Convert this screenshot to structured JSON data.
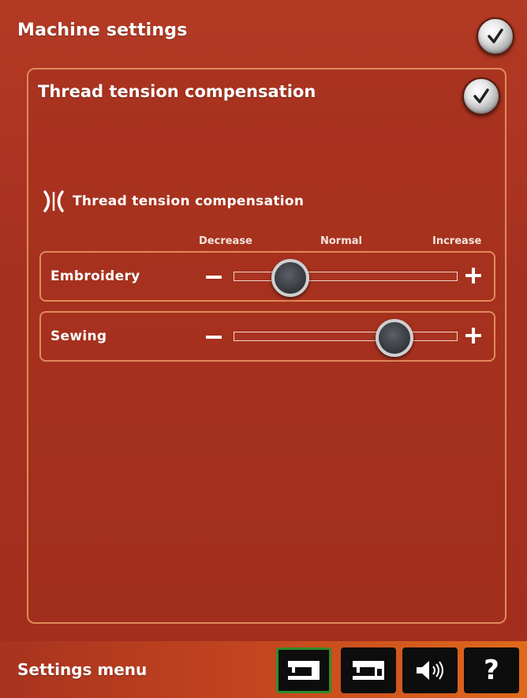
{
  "header": {
    "title": "Machine settings",
    "confirm_icon": "checkmark-icon"
  },
  "panel": {
    "title": "Thread tension compensation",
    "confirm_icon": "checkmark-icon",
    "setting_label": "Thread tension compensation",
    "setting_icon": "thread-tension-icon",
    "scale": {
      "decrease": "Decrease",
      "normal": "Normal",
      "increase": "Increase"
    },
    "sliders": [
      {
        "label": "Embroidery",
        "minus": "−",
        "plus": "+",
        "value": 0.25
      },
      {
        "label": "Sewing",
        "minus": "−",
        "plus": "+",
        "value": 0.72
      }
    ]
  },
  "footer": {
    "title": "Settings menu",
    "tabs": [
      {
        "icon": "sewing-machine-icon",
        "active": true
      },
      {
        "icon": "machine-settings-icon",
        "active": false
      },
      {
        "icon": "speaker-icon",
        "active": false
      },
      {
        "icon": "help-icon",
        "label": "?",
        "active": false
      }
    ]
  },
  "colors": {
    "background": "#a8321f",
    "outline": "#e08a5a",
    "active_tab_border": "#2f8c2c"
  }
}
